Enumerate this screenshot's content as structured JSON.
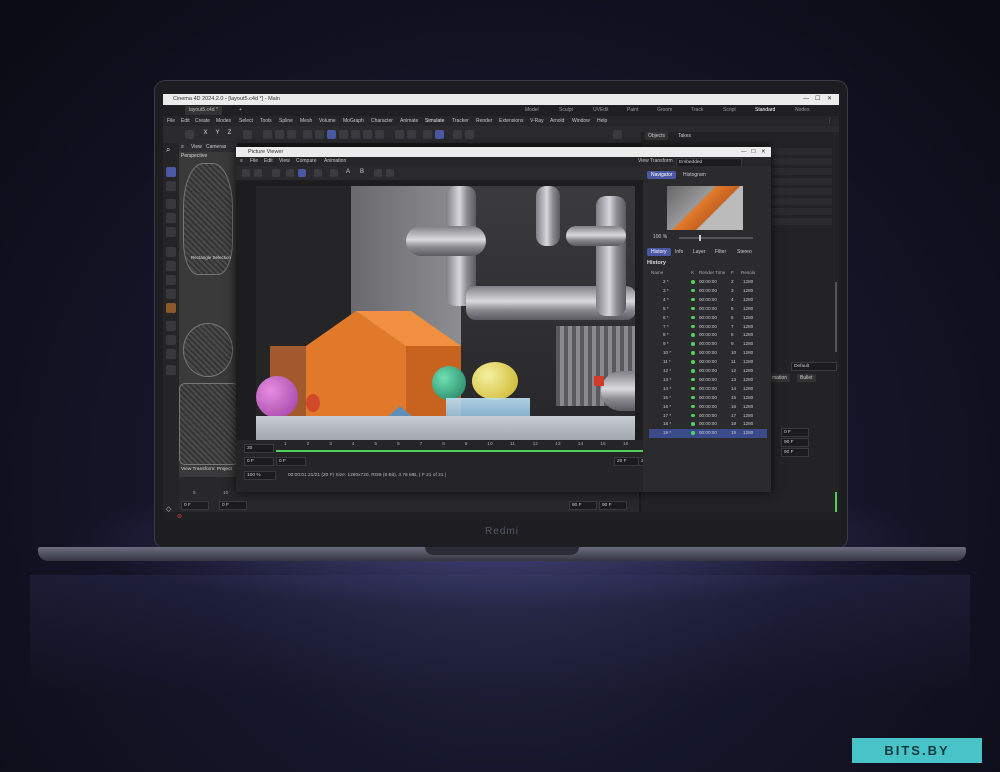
{
  "app": {
    "title": "Cinema 4D 2024.2.0 - [layout5.c4d *] - Main",
    "doc_tab": "layout5.c4d *",
    "new_tab": "+",
    "workspaces": [
      "Model",
      "Sculpt",
      "UVEdit",
      "Paint",
      "Groom",
      "Track",
      "Script",
      "Standard",
      "Nodes"
    ],
    "active_workspace": "Standard",
    "menu": [
      "File",
      "Edit",
      "Create",
      "Modes",
      "Select",
      "Tools",
      "Spline",
      "Mesh",
      "Volume",
      "MoGraph",
      "Character",
      "Animate",
      "Simulate",
      "Tracker",
      "Render",
      "Extensions",
      "V-Ray",
      "Arnold",
      "Window",
      "Help"
    ],
    "axis_buttons": [
      "X",
      "Y",
      "Z"
    ]
  },
  "viewport": {
    "menu": [
      "View",
      "Cameras"
    ],
    "name": "Perspective",
    "selection_label": "Rectangle Selection",
    "footer": "View Transform: Project"
  },
  "objects_panel": {
    "tabs": [
      "Objects",
      "Takes"
    ],
    "dropdown": "Default",
    "animation_label": "mation",
    "bullet_label": "Bullet",
    "frames": [
      "0 F",
      "90 F",
      "90 F"
    ]
  },
  "timeline": {
    "start": "0 F",
    "start2": "0 F",
    "end": "90 F",
    "end2": "90 F",
    "ruler": [
      "5",
      "10"
    ]
  },
  "picture_viewer": {
    "title": "Picture Viewer",
    "menu": [
      "File",
      "Edit",
      "View",
      "Compare",
      "Animation"
    ],
    "view_transform_label": "View Transform",
    "view_transform_value": "Embedded",
    "tool_letters": [
      "A",
      "B"
    ],
    "nav_tabs": [
      "Navigator",
      "Histogram"
    ],
    "zoom": "100 %",
    "sub_tabs": [
      "History",
      "Info",
      "Layer",
      "Filter",
      "Stereo"
    ],
    "history_label": "History",
    "columns": [
      "Name",
      "K",
      "Render Time",
      "F",
      "Resolu"
    ],
    "rows": [
      {
        "name": "2 *",
        "time": "00:00:00",
        "f": "2",
        "res": "1280"
      },
      {
        "name": "3 *",
        "time": "00:00:00",
        "f": "3",
        "res": "1280"
      },
      {
        "name": "4 *",
        "time": "00:00:00",
        "f": "4",
        "res": "1280"
      },
      {
        "name": "5 *",
        "time": "00:00:00",
        "f": "5",
        "res": "1280"
      },
      {
        "name": "6 *",
        "time": "00:00:00",
        "f": "6",
        "res": "1280"
      },
      {
        "name": "7 *",
        "time": "00:00:00",
        "f": "7",
        "res": "1280"
      },
      {
        "name": "8 *",
        "time": "00:00:00",
        "f": "8",
        "res": "1280"
      },
      {
        "name": "9 *",
        "time": "00:00:00",
        "f": "9",
        "res": "1280"
      },
      {
        "name": "10 *",
        "time": "00:00:00",
        "f": "10",
        "res": "1280"
      },
      {
        "name": "11 *",
        "time": "00:00:00",
        "f": "11",
        "res": "1280"
      },
      {
        "name": "12 *",
        "time": "00:00:00",
        "f": "12",
        "res": "1280"
      },
      {
        "name": "13 *",
        "time": "00:00:00",
        "f": "13",
        "res": "1280"
      },
      {
        "name": "14 *",
        "time": "00:00:00",
        "f": "14",
        "res": "1280"
      },
      {
        "name": "15 *",
        "time": "00:00:00",
        "f": "15",
        "res": "1280"
      },
      {
        "name": "16 *",
        "time": "00:00:00",
        "f": "16",
        "res": "1280"
      },
      {
        "name": "17 *",
        "time": "00:00:00",
        "f": "17",
        "res": "1280"
      },
      {
        "name": "18 *",
        "time": "00:00:00",
        "f": "18",
        "res": "1280"
      },
      {
        "name": "19 *",
        "time": "00:00:00",
        "f": "19",
        "res": "1280"
      }
    ],
    "frame_field": "30",
    "frame_ruler": [
      "1",
      "2",
      "3",
      "4",
      "5",
      "6",
      "7",
      "8",
      "9",
      "10",
      "11",
      "12",
      "13",
      "14",
      "15",
      "16",
      "17",
      "18",
      "19"
    ],
    "frame_end_field": "20 F",
    "range_start": "0 F",
    "range_start2": "0 F",
    "range_end": "20 F",
    "range_end2": "20 F",
    "zoom_field": "100 %",
    "status": "00:00:01 21/21 (20 F)   Size: 1280x720, RGB (8 Bit), 3.78 MB,  ( F 21 of 21 )"
  },
  "laptop": {
    "brand": "Redmi"
  },
  "watermark": "BITS.BY",
  "colors": {
    "accent": "#4b59a5",
    "workspace_active": "#6aa0ff",
    "render_ok": "#4fd05d",
    "watermark_bg": "#48c4c8"
  }
}
